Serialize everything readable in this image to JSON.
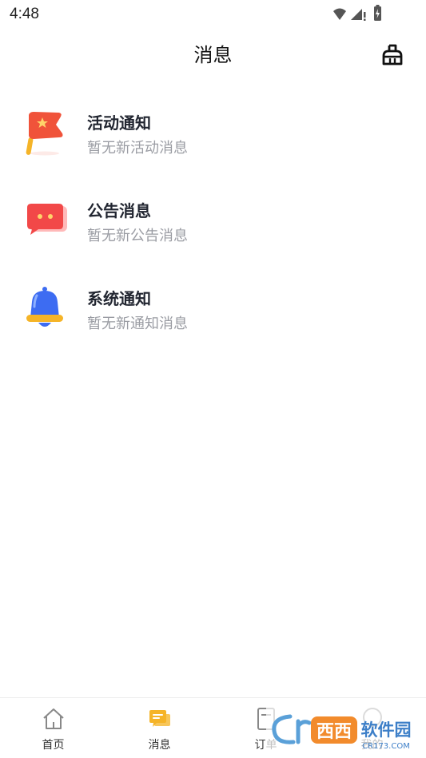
{
  "status_bar": {
    "time": "4:48"
  },
  "header": {
    "title": "消息"
  },
  "messages": [
    {
      "title": "活动通知",
      "subtitle": "暂无新活动消息",
      "icon": "flag-icon"
    },
    {
      "title": "公告消息",
      "subtitle": "暂无新公告消息",
      "icon": "chat-bubble-icon"
    },
    {
      "title": "系统通知",
      "subtitle": "暂无新通知消息",
      "icon": "bell-icon"
    }
  ],
  "tabbar": {
    "tabs": [
      {
        "label": "首页",
        "icon": "home-icon"
      },
      {
        "label": "消息",
        "icon": "message-icon",
        "active": true
      },
      {
        "label": "订单",
        "icon": "order-icon"
      },
      {
        "label": "我的",
        "icon": "profile-icon"
      }
    ]
  },
  "watermark": {
    "text": "西西软件园",
    "sub": "CR173.COM"
  },
  "colors": {
    "accent": "#f5b428",
    "flag_red": "#f0533a",
    "bubble_red": "#f24848",
    "bell_blue": "#3d6cf2",
    "subtitle_gray": "#9a9ca3"
  }
}
